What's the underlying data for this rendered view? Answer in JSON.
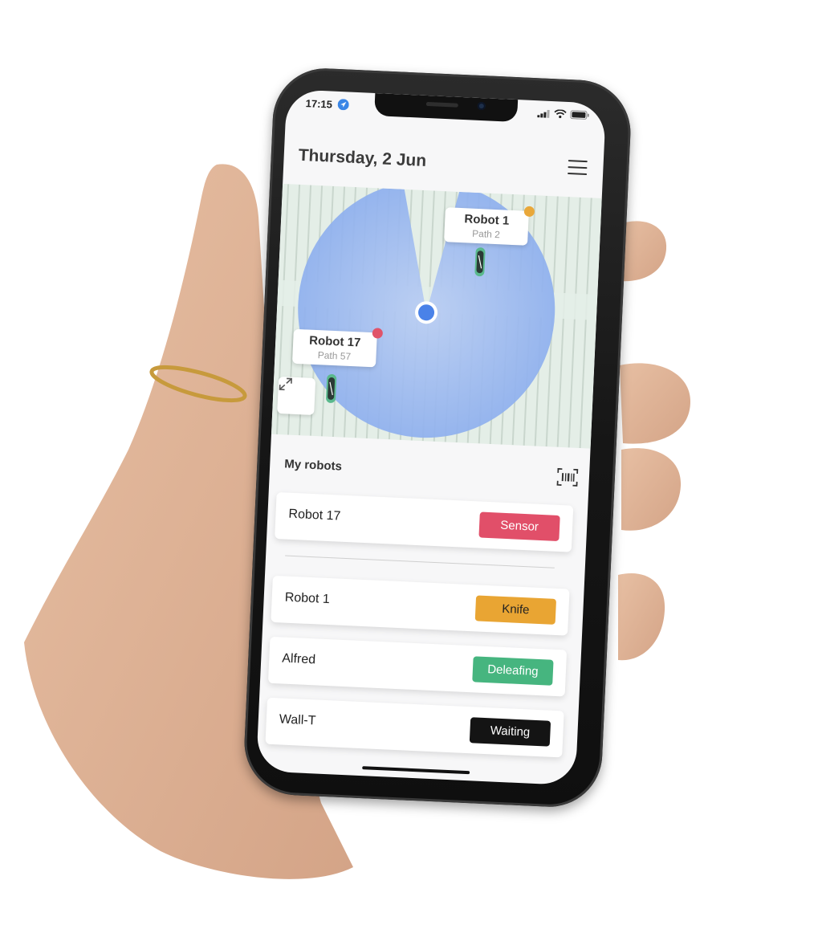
{
  "status_bar": {
    "time": "17:15",
    "icons": [
      "location-arrow-icon",
      "signal-icon",
      "wifi-icon",
      "battery-icon"
    ]
  },
  "header": {
    "title": "Thursday, 2 Jun",
    "menu_icon": "hamburger-menu-icon"
  },
  "map": {
    "robots": [
      {
        "name": "Robot 1",
        "path": "Path 2",
        "dot_color": "#e9a83a"
      },
      {
        "name": "Robot 17",
        "path": "Path 57",
        "dot_color": "#e0546a"
      }
    ],
    "expand_icon": "expand-arrows-icon",
    "coverage_color": "#8fb0ee",
    "user_dot_color": "#4a82e8"
  },
  "robots_list": {
    "title": "My robots",
    "scan_icon": "barcode-scan-icon",
    "items": [
      {
        "name": "Robot 17",
        "status": "Sensor",
        "status_color": "#e14f69"
      },
      {
        "name": "Robot 1",
        "status": "Knife",
        "status_color": "#e9a533"
      },
      {
        "name": "Alfred",
        "status": "Deleafing",
        "status_color": "#46b57f"
      },
      {
        "name": "Wall-T",
        "status": "Waiting",
        "status_color": "#141414"
      }
    ]
  }
}
